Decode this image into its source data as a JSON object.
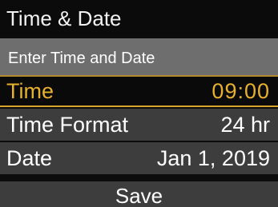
{
  "header": {
    "title": "Time & Date"
  },
  "subheader": {
    "text": "Enter Time and Date"
  },
  "rows": [
    {
      "label": "Time",
      "value": "09:00",
      "selected": true
    },
    {
      "label": "Time Format",
      "value": "24 hr",
      "selected": false
    },
    {
      "label": "Date",
      "value": "Jan 1, 2019",
      "selected": false
    }
  ],
  "footer": {
    "save_label": "Save"
  },
  "colors": {
    "accent": "#e7b02e",
    "row_bg": "#3d3d3d",
    "subheader_bg": "#6e6e6e",
    "background": "#0c0c0c"
  }
}
